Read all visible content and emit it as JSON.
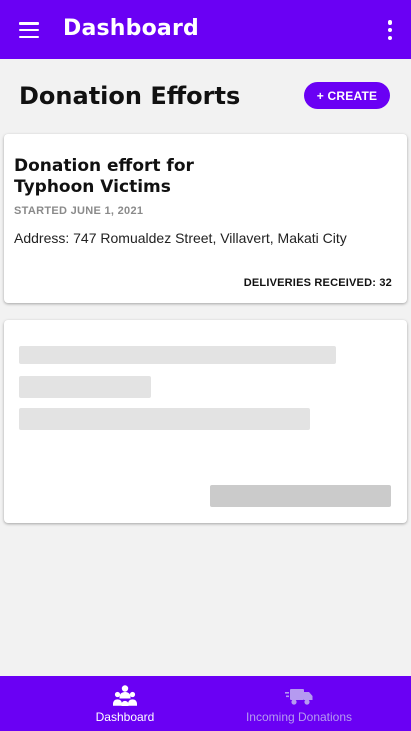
{
  "appbar": {
    "title": "Dashboard",
    "menu_icon": "menu-icon",
    "more_icon": "more-vert-icon",
    "background": "#6a00f4"
  },
  "page": {
    "title": "Donation Efforts",
    "create_label": "+ CREATE"
  },
  "donation_cards": [
    {
      "title": "Donation effort for Typhoon Victims",
      "started": "STARTED JUNE 1, 2021",
      "address_label": "Address:",
      "address": "747 Romualdez Street, Villavert, Makati City",
      "deliveries_label": "DELIVERIES RECEIVED:",
      "deliveries_count": "32"
    }
  ],
  "bottom_nav": {
    "items": [
      {
        "label": "Dashboard",
        "icon": "people-icon",
        "active": true
      },
      {
        "label": "Incoming Donations",
        "icon": "truck-icon",
        "active": false
      }
    ],
    "active_color": "#ffffff",
    "inactive_color": "#b59af0"
  }
}
